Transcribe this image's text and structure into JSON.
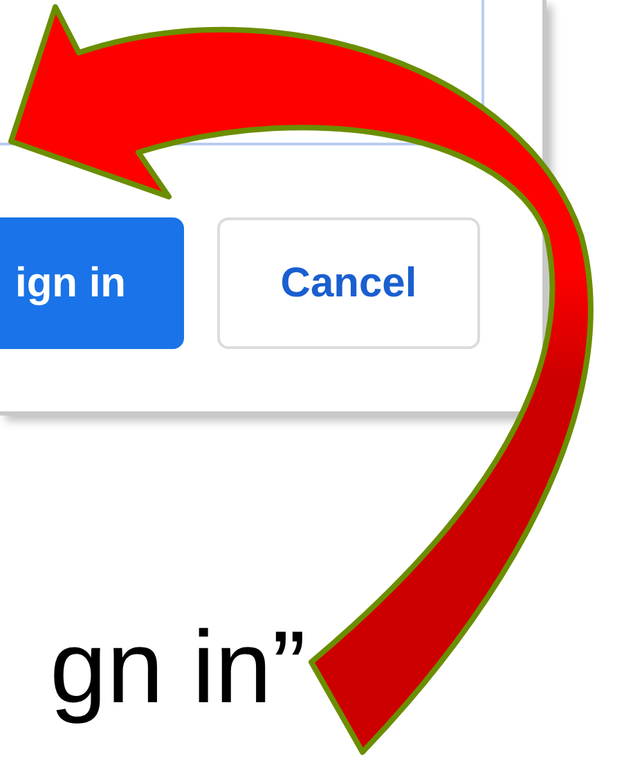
{
  "dialog": {
    "buttons": [
      {
        "kind": "primary",
        "label": "ign in"
      },
      {
        "kind": "secondary",
        "label": "Cancel"
      }
    ]
  },
  "caption": "gn in”"
}
